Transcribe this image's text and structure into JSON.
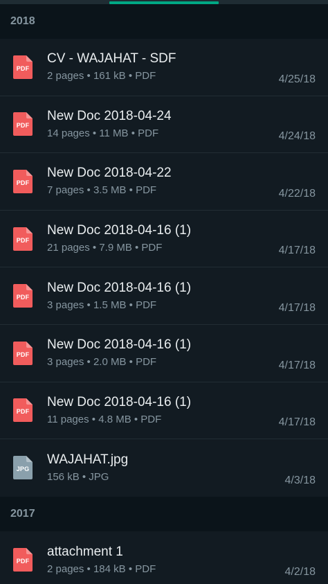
{
  "colors": {
    "background": "#121b22",
    "accent": "#00a884",
    "pdf_icon": "#f15c5c",
    "jpg_icon": "#8aa0ac"
  },
  "sections": [
    {
      "year": "2018",
      "items": [
        {
          "title": "CV - WAJAHAT - SDF",
          "meta": "2 pages • 161 kB • PDF",
          "date": "4/25/18",
          "ext": "PDF",
          "icon": "pdf-icon"
        },
        {
          "title": "New Doc 2018-04-24",
          "meta": "14 pages • 11 MB • PDF",
          "date": "4/24/18",
          "ext": "PDF",
          "icon": "pdf-icon"
        },
        {
          "title": "New Doc 2018-04-22",
          "meta": "7 pages • 3.5 MB • PDF",
          "date": "4/22/18",
          "ext": "PDF",
          "icon": "pdf-icon"
        },
        {
          "title": "New Doc 2018-04-16 (1)",
          "meta": "21 pages • 7.9 MB • PDF",
          "date": "4/17/18",
          "ext": "PDF",
          "icon": "pdf-icon"
        },
        {
          "title": "New Doc 2018-04-16 (1)",
          "meta": "3 pages • 1.5 MB • PDF",
          "date": "4/17/18",
          "ext": "PDF",
          "icon": "pdf-icon"
        },
        {
          "title": "New Doc 2018-04-16 (1)",
          "meta": "3 pages • 2.0 MB • PDF",
          "date": "4/17/18",
          "ext": "PDF",
          "icon": "pdf-icon"
        },
        {
          "title": "New Doc 2018-04-16 (1)",
          "meta": "11 pages • 4.8 MB • PDF",
          "date": "4/17/18",
          "ext": "PDF",
          "icon": "pdf-icon"
        },
        {
          "title": "WAJAHAT.jpg",
          "meta": "156 kB • JPG",
          "date": "4/3/18",
          "ext": "JPG",
          "icon": "jpg-icon"
        }
      ]
    },
    {
      "year": "2017",
      "items": [
        {
          "title": "attachment 1",
          "meta": "2 pages • 184 kB • PDF",
          "date": "4/2/18",
          "ext": "PDF",
          "icon": "pdf-icon"
        }
      ]
    }
  ]
}
